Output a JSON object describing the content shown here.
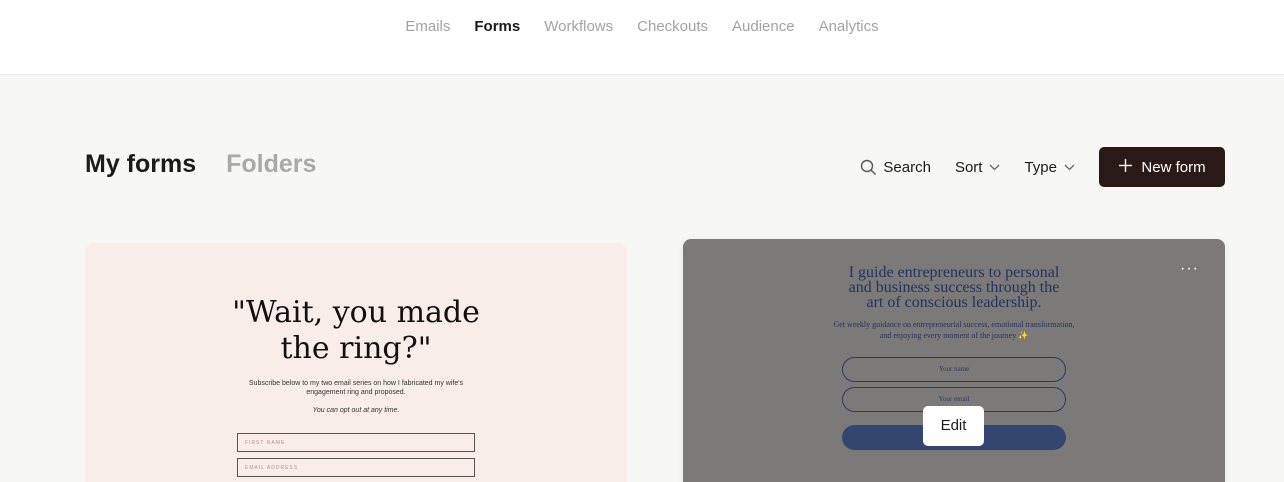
{
  "nav": {
    "items": [
      {
        "label": "Emails"
      },
      {
        "label": "Forms"
      },
      {
        "label": "Workflows"
      },
      {
        "label": "Checkouts"
      },
      {
        "label": "Audience"
      },
      {
        "label": "Analytics"
      }
    ],
    "active": "Forms"
  },
  "page": {
    "title": "My forms",
    "folders_tab": "Folders"
  },
  "toolbar": {
    "search_label": "Search",
    "sort_label": "Sort",
    "type_label": "Type",
    "new_form_label": "New form"
  },
  "forms": [
    {
      "headline_line1": "\"Wait, you made",
      "headline_line2": "the ring?\"",
      "subtext": "Subscribe below to my two email series on how I fabricated my wife's engagement ring and proposed.",
      "note": "You can opt out at any time.",
      "field1": "FIRST NAME",
      "field2": "EMAIL ADDRESS"
    },
    {
      "headline_line1": "I guide entrepreneurs to personal",
      "headline_line2": "and business success through the",
      "headline_line3": "art of conscious leadership.",
      "subtext": "Get weekly guidance on entrepreneurial success, emotional transformation, and enjoying every moment of the journey ✨",
      "field1": "Your name",
      "field2": "Your email",
      "more_label": "···",
      "edit_label": "Edit"
    }
  ],
  "colors": {
    "primary_button": "#2a1a17",
    "card1_bg": "#f8ede9",
    "card2_overlay": "#7c7a78",
    "card2_text": "#223460"
  }
}
